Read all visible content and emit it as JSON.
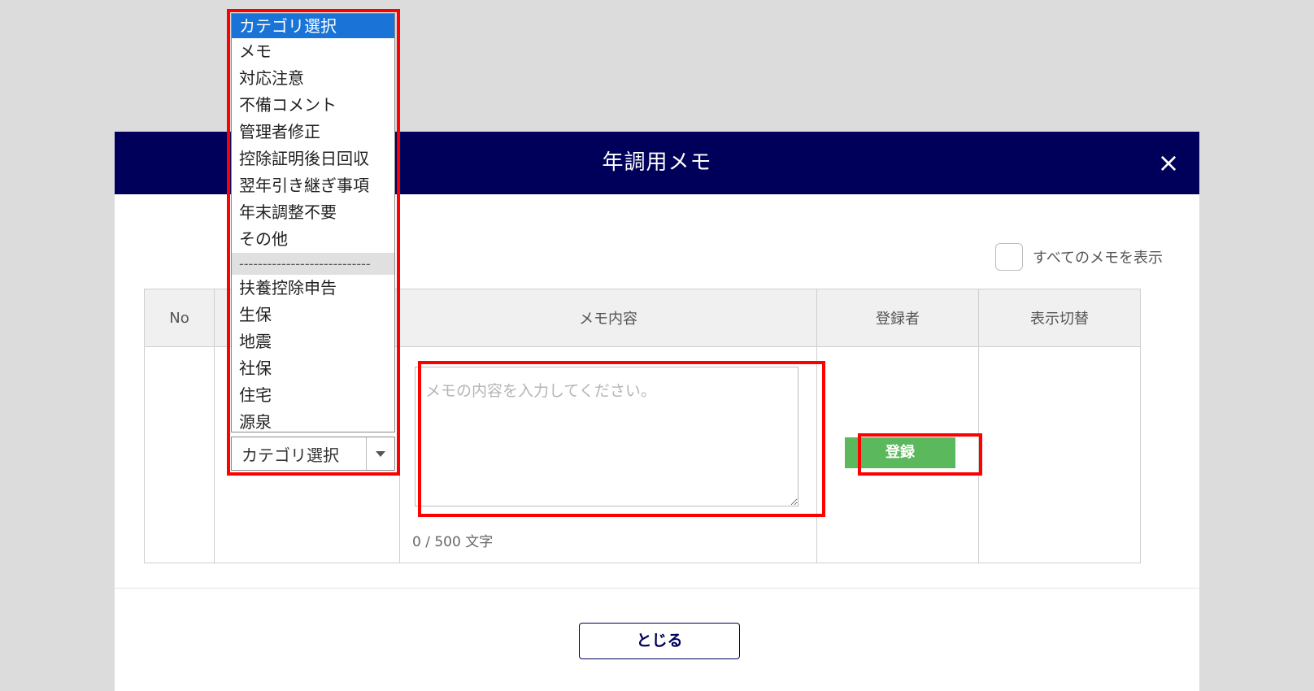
{
  "modal": {
    "title": "年調用メモ",
    "close_icon": "×",
    "show_all_label": "すべてのメモを表示",
    "close_button_label": "とじる"
  },
  "table": {
    "headers": [
      "No",
      "",
      "メモ内容",
      "登録者",
      "表示切替"
    ],
    "memo_placeholder": "メモの内容を入力してください。",
    "char_count": "0 / 500 文字",
    "register_label": "登録"
  },
  "category_dropdown": {
    "selected": "カテゴリ選択",
    "options": [
      "カテゴリ選択",
      "メモ",
      "対応注意",
      "不備コメント",
      "管理者修正",
      "控除証明後日回収",
      "翌年引き継ぎ事項",
      "年末調整不要",
      "その他",
      "----------------------------",
      "扶養控除申告",
      "生保",
      "地震",
      "社保",
      "住宅",
      "源泉"
    ]
  },
  "colors": {
    "header_bg": "#00005a",
    "register_bg": "#5cb85c",
    "highlight": "#ff0000",
    "selected_option": "#1a73d6"
  }
}
